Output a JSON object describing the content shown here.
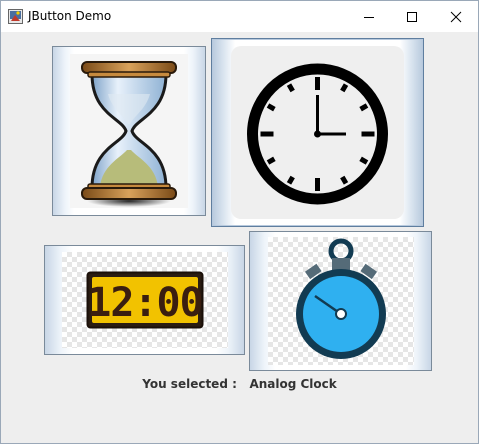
{
  "window": {
    "title": "JButton Demo"
  },
  "buttons": [
    {
      "name": "Hourglass",
      "icon": "hourglass-icon"
    },
    {
      "name": "Analog Clock",
      "icon": "analog-clock-icon",
      "selected": true
    },
    {
      "name": "Digital Clock",
      "icon": "digital-clock-icon",
      "display": "12:00"
    },
    {
      "name": "Stopwatch",
      "icon": "stopwatch-icon"
    }
  ],
  "status": {
    "label": "You selected :",
    "value": "Analog Clock"
  }
}
